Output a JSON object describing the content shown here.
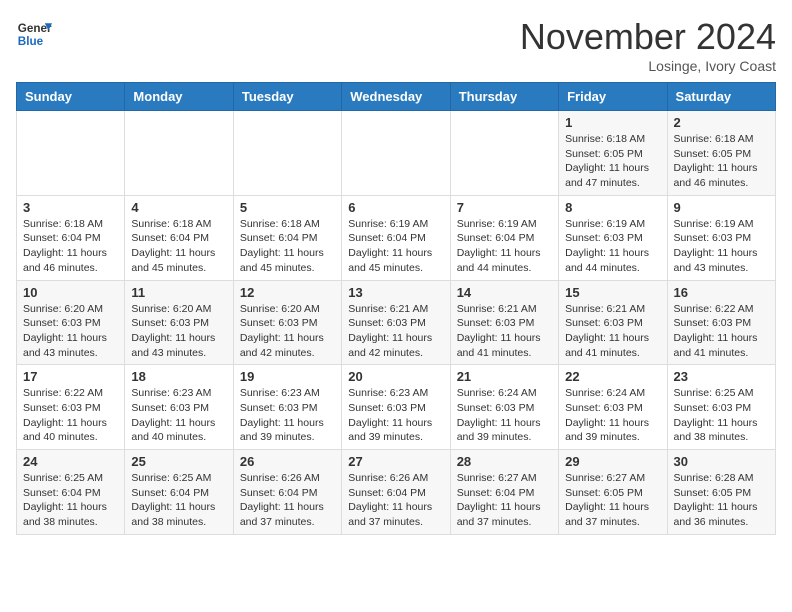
{
  "header": {
    "logo_general": "General",
    "logo_blue": "Blue",
    "month_title": "November 2024",
    "location": "Losinge, Ivory Coast"
  },
  "weekdays": [
    "Sunday",
    "Monday",
    "Tuesday",
    "Wednesday",
    "Thursday",
    "Friday",
    "Saturday"
  ],
  "weeks": [
    [
      {
        "day": "",
        "info": ""
      },
      {
        "day": "",
        "info": ""
      },
      {
        "day": "",
        "info": ""
      },
      {
        "day": "",
        "info": ""
      },
      {
        "day": "",
        "info": ""
      },
      {
        "day": "1",
        "info": "Sunrise: 6:18 AM\nSunset: 6:05 PM\nDaylight: 11 hours\nand 47 minutes."
      },
      {
        "day": "2",
        "info": "Sunrise: 6:18 AM\nSunset: 6:05 PM\nDaylight: 11 hours\nand 46 minutes."
      }
    ],
    [
      {
        "day": "3",
        "info": "Sunrise: 6:18 AM\nSunset: 6:04 PM\nDaylight: 11 hours\nand 46 minutes."
      },
      {
        "day": "4",
        "info": "Sunrise: 6:18 AM\nSunset: 6:04 PM\nDaylight: 11 hours\nand 45 minutes."
      },
      {
        "day": "5",
        "info": "Sunrise: 6:18 AM\nSunset: 6:04 PM\nDaylight: 11 hours\nand 45 minutes."
      },
      {
        "day": "6",
        "info": "Sunrise: 6:19 AM\nSunset: 6:04 PM\nDaylight: 11 hours\nand 45 minutes."
      },
      {
        "day": "7",
        "info": "Sunrise: 6:19 AM\nSunset: 6:04 PM\nDaylight: 11 hours\nand 44 minutes."
      },
      {
        "day": "8",
        "info": "Sunrise: 6:19 AM\nSunset: 6:03 PM\nDaylight: 11 hours\nand 44 minutes."
      },
      {
        "day": "9",
        "info": "Sunrise: 6:19 AM\nSunset: 6:03 PM\nDaylight: 11 hours\nand 43 minutes."
      }
    ],
    [
      {
        "day": "10",
        "info": "Sunrise: 6:20 AM\nSunset: 6:03 PM\nDaylight: 11 hours\nand 43 minutes."
      },
      {
        "day": "11",
        "info": "Sunrise: 6:20 AM\nSunset: 6:03 PM\nDaylight: 11 hours\nand 43 minutes."
      },
      {
        "day": "12",
        "info": "Sunrise: 6:20 AM\nSunset: 6:03 PM\nDaylight: 11 hours\nand 42 minutes."
      },
      {
        "day": "13",
        "info": "Sunrise: 6:21 AM\nSunset: 6:03 PM\nDaylight: 11 hours\nand 42 minutes."
      },
      {
        "day": "14",
        "info": "Sunrise: 6:21 AM\nSunset: 6:03 PM\nDaylight: 11 hours\nand 41 minutes."
      },
      {
        "day": "15",
        "info": "Sunrise: 6:21 AM\nSunset: 6:03 PM\nDaylight: 11 hours\nand 41 minutes."
      },
      {
        "day": "16",
        "info": "Sunrise: 6:22 AM\nSunset: 6:03 PM\nDaylight: 11 hours\nand 41 minutes."
      }
    ],
    [
      {
        "day": "17",
        "info": "Sunrise: 6:22 AM\nSunset: 6:03 PM\nDaylight: 11 hours\nand 40 minutes."
      },
      {
        "day": "18",
        "info": "Sunrise: 6:23 AM\nSunset: 6:03 PM\nDaylight: 11 hours\nand 40 minutes."
      },
      {
        "day": "19",
        "info": "Sunrise: 6:23 AM\nSunset: 6:03 PM\nDaylight: 11 hours\nand 39 minutes."
      },
      {
        "day": "20",
        "info": "Sunrise: 6:23 AM\nSunset: 6:03 PM\nDaylight: 11 hours\nand 39 minutes."
      },
      {
        "day": "21",
        "info": "Sunrise: 6:24 AM\nSunset: 6:03 PM\nDaylight: 11 hours\nand 39 minutes."
      },
      {
        "day": "22",
        "info": "Sunrise: 6:24 AM\nSunset: 6:03 PM\nDaylight: 11 hours\nand 39 minutes."
      },
      {
        "day": "23",
        "info": "Sunrise: 6:25 AM\nSunset: 6:03 PM\nDaylight: 11 hours\nand 38 minutes."
      }
    ],
    [
      {
        "day": "24",
        "info": "Sunrise: 6:25 AM\nSunset: 6:04 PM\nDaylight: 11 hours\nand 38 minutes."
      },
      {
        "day": "25",
        "info": "Sunrise: 6:25 AM\nSunset: 6:04 PM\nDaylight: 11 hours\nand 38 minutes."
      },
      {
        "day": "26",
        "info": "Sunrise: 6:26 AM\nSunset: 6:04 PM\nDaylight: 11 hours\nand 37 minutes."
      },
      {
        "day": "27",
        "info": "Sunrise: 6:26 AM\nSunset: 6:04 PM\nDaylight: 11 hours\nand 37 minutes."
      },
      {
        "day": "28",
        "info": "Sunrise: 6:27 AM\nSunset: 6:04 PM\nDaylight: 11 hours\nand 37 minutes."
      },
      {
        "day": "29",
        "info": "Sunrise: 6:27 AM\nSunset: 6:05 PM\nDaylight: 11 hours\nand 37 minutes."
      },
      {
        "day": "30",
        "info": "Sunrise: 6:28 AM\nSunset: 6:05 PM\nDaylight: 11 hours\nand 36 minutes."
      }
    ]
  ]
}
